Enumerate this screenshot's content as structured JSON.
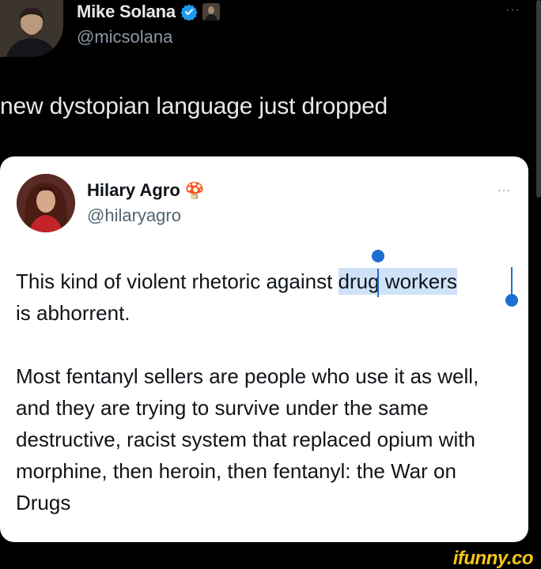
{
  "outer_tweet": {
    "name": "Mike Solana",
    "handle": "@micsolana",
    "more": "···",
    "text": "new dystopian language just dropped"
  },
  "quoted_tweet": {
    "name": "Hilary Agro",
    "name_emoji": "🍄",
    "handle": "@hilaryagro",
    "more": "···",
    "para1_before": "This kind of violent rhetoric against ",
    "para1_selected": "drug workers",
    "para1_after": "is abhorrent.",
    "para2": "Most fentanyl sellers are people who use it as well, and they are trying to survive under the same destructive, racist system that replaced opium with morphine, then heroin, then fentanyl: the War on Drugs"
  },
  "watermark": "ifunny.co",
  "colors": {
    "verified": "#1d9bf0",
    "selection": "#cfe2f7",
    "selection_handle": "#1d6fd1",
    "watermark": "#f5c518"
  }
}
